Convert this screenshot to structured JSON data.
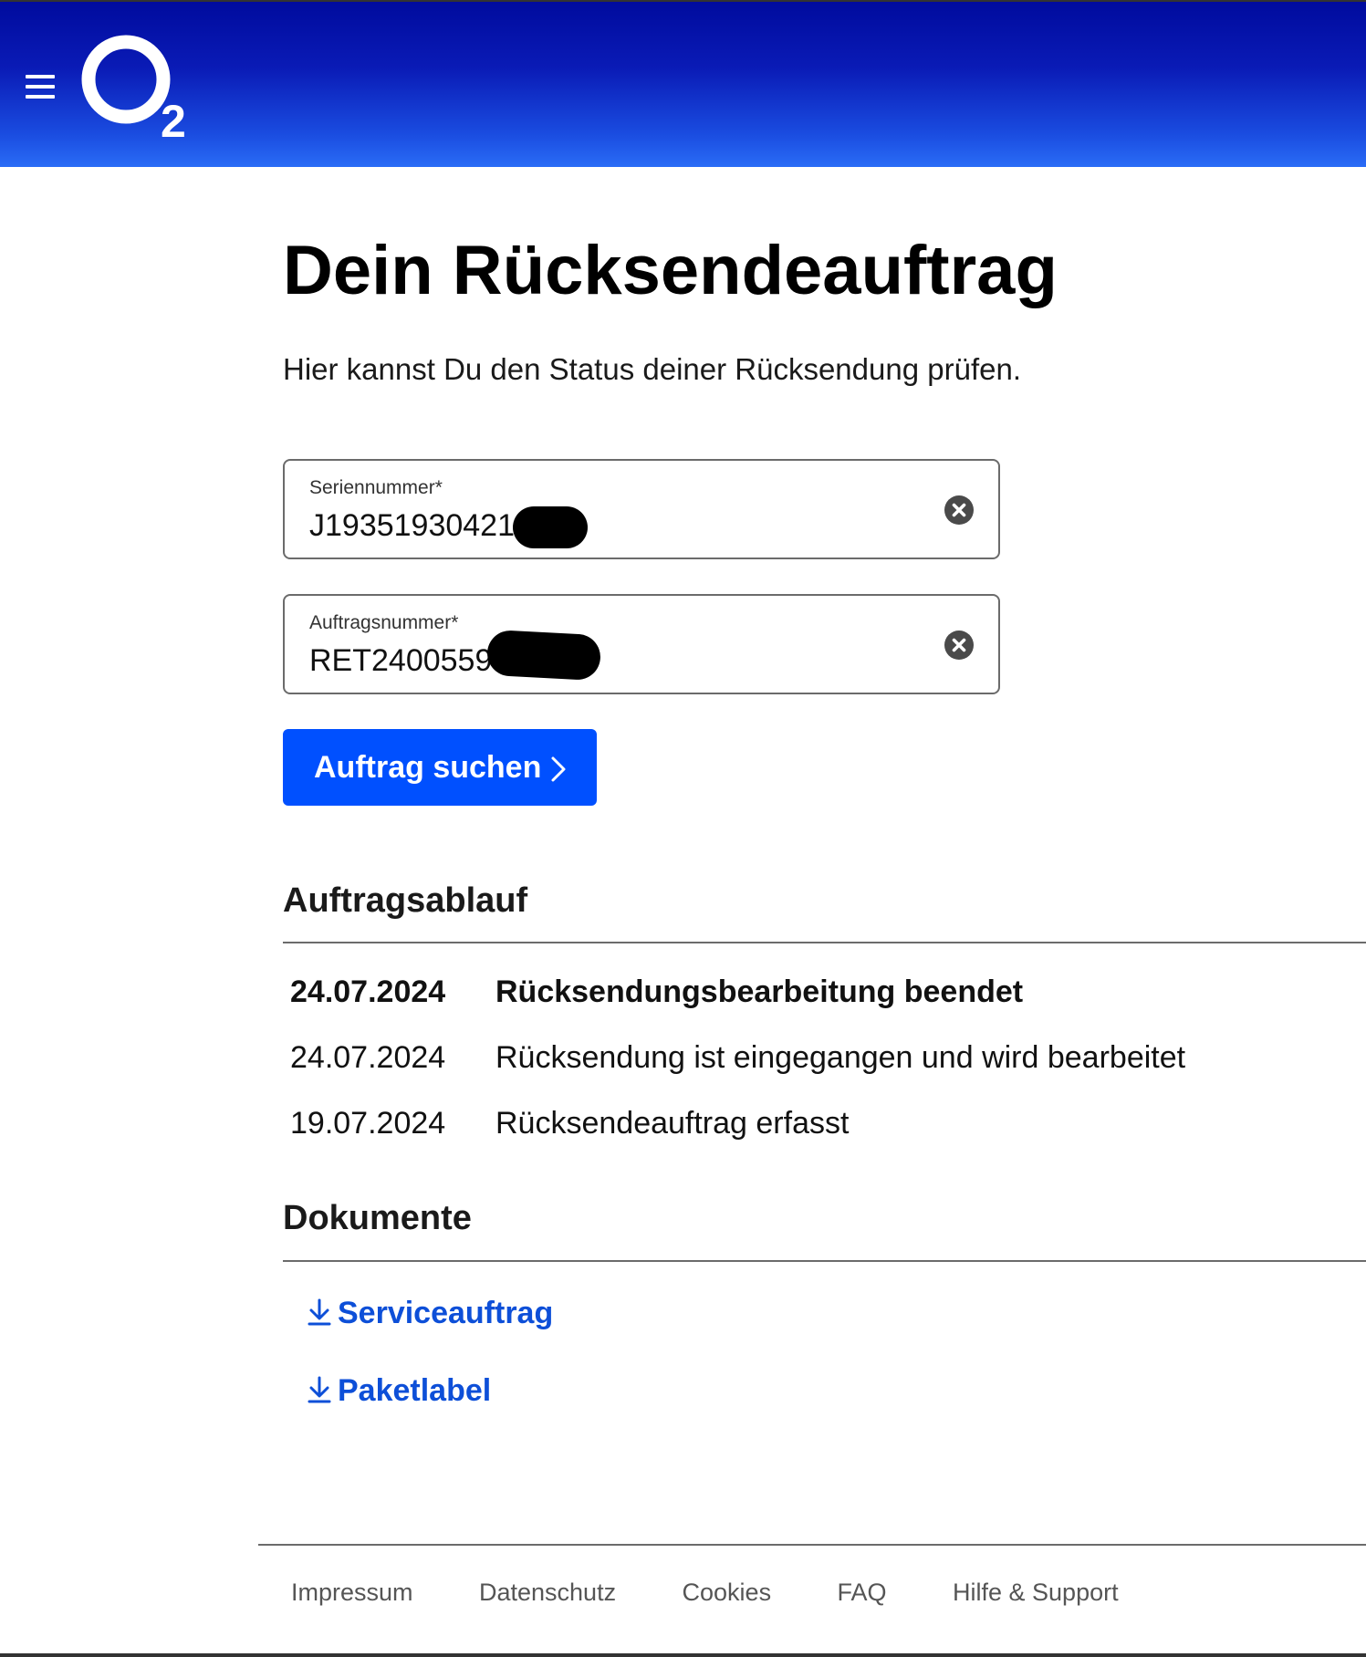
{
  "header": {
    "logo_text": "O2",
    "menu_icon": "hamburger-menu-icon",
    "background_top": "#000b9e",
    "background_bottom": "#2a6cf6"
  },
  "page": {
    "title": "Dein Rücksendeauftrag",
    "subtitle": "Hier kannst Du den Status deiner Rücksendung prüfen."
  },
  "form": {
    "serial": {
      "label": "Seriennummer*",
      "value": "J193519304211"
    },
    "order": {
      "label": "Auftragsnummer*",
      "value": "RET2400559"
    },
    "clear_icon": "clear-circle-icon",
    "submit_label": "Auftrag suchen",
    "submit_color": "#0050ff"
  },
  "timeline": {
    "title": "Auftragsablauf",
    "entries": [
      {
        "date": "24.07.2024",
        "text": "Rücksendungsbearbeitung beendet"
      },
      {
        "date": "24.07.2024",
        "text": "Rücksendung ist eingegangen und wird bearbeitet"
      },
      {
        "date": "19.07.2024",
        "text": "Rücksendeauftrag erfasst"
      }
    ]
  },
  "documents": {
    "title": "Dokumente",
    "link_color": "#0d4fd8",
    "items": [
      {
        "label": "Serviceauftrag",
        "icon": "download-icon"
      },
      {
        "label": "Paketlabel",
        "icon": "download-icon"
      }
    ]
  },
  "footer": {
    "links": [
      "Impressum",
      "Datenschutz",
      "Cookies",
      "FAQ",
      "Hilfe & Support"
    ]
  }
}
